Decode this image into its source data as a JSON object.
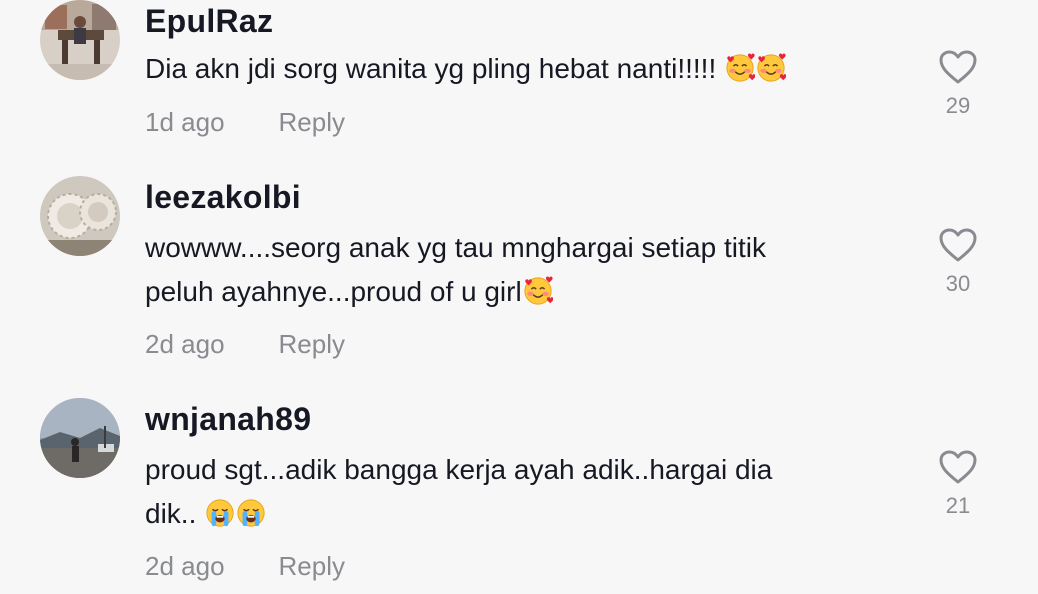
{
  "comments": [
    {
      "username": "EpulRaz",
      "lines": [
        "Dia akn jdi sorg wanita yg pling hebat nanti!!!!!"
      ],
      "emoji": [
        "smiling-face-with-hearts-icon",
        "smiling-face-with-hearts-icon"
      ],
      "time": "1d ago",
      "reply_label": "Reply",
      "likes": "29"
    },
    {
      "username": "leezakolbi",
      "lines": [
        "wowww....seorg anak yg tau mnghargai setiap titik",
        "peluh ayahnye...proud of u girl"
      ],
      "emoji": [
        "smiling-face-with-hearts-icon"
      ],
      "time": "2d ago",
      "reply_label": "Reply",
      "likes": "30"
    },
    {
      "username": "wnjanah89",
      "lines": [
        "proud sgt...adik bangga kerja ayah adik..hargai dia",
        "dik.. "
      ],
      "emoji": [
        "loudly-crying-face-icon",
        "loudly-crying-face-icon"
      ],
      "time": "2d ago",
      "reply_label": "Reply",
      "likes": "21"
    }
  ],
  "colors": {
    "background": "#f7f7f7",
    "text": "#161823",
    "secondary": "#8a8b91"
  }
}
